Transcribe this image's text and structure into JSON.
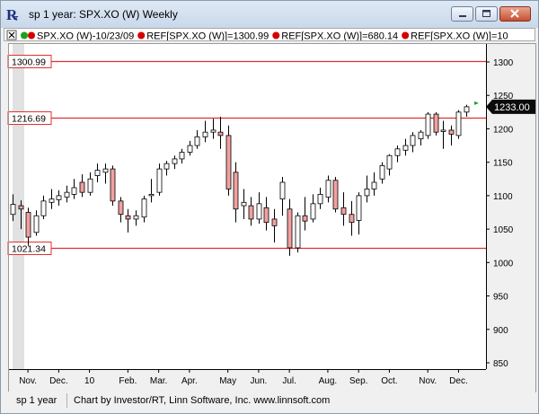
{
  "window": {
    "title": "sp 1 year: SPX.XO (W) Weekly"
  },
  "legend": {
    "items": [
      {
        "text": "SPX.XO (W)-10/23/09",
        "dots": [
          "#1ea01e",
          "#d40000"
        ]
      },
      {
        "text": "REF[SPX.XO (W)]=1300.99",
        "dots": [
          "#d40000"
        ]
      },
      {
        "text": "REF[SPX.XO (W)]=680.14",
        "dots": [
          "#d40000"
        ]
      },
      {
        "text": "REF[SPX.XO (W)]=10",
        "dots": [
          "#d40000"
        ]
      }
    ]
  },
  "status": {
    "left": "sp 1 year",
    "right": "Chart by Investor/RT, Linn Software, Inc. www.linnsoft.com"
  },
  "chart_data": {
    "type": "candlestick",
    "symbol": "SPX.XO (W)",
    "title": "",
    "ylim": [
      850,
      1310
    ],
    "yticks": [
      850,
      900,
      950,
      1000,
      1050,
      1100,
      1150,
      1200,
      1250,
      1300
    ],
    "x_labels": [
      {
        "label": "Nov.",
        "index": 2
      },
      {
        "label": "Dec.",
        "index": 6
      },
      {
        "label": "10",
        "index": 10
      },
      {
        "label": "Feb.",
        "index": 15
      },
      {
        "label": "Mar.",
        "index": 19
      },
      {
        "label": "Apr.",
        "index": 23
      },
      {
        "label": "May",
        "index": 28
      },
      {
        "label": "Jun.",
        "index": 32
      },
      {
        "label": "Jul.",
        "index": 36
      },
      {
        "label": "Aug.",
        "index": 41
      },
      {
        "label": "Sep.",
        "index": 45
      },
      {
        "label": "Oct.",
        "index": 49
      },
      {
        "label": "Nov.",
        "index": 54
      },
      {
        "label": "Dec.",
        "index": 58
      }
    ],
    "reference_lines": [
      {
        "label": "1300.99",
        "value": 1300.99,
        "color": "#e03030"
      },
      {
        "label": "1216.69",
        "value": 1216.69,
        "color": "#e03030"
      },
      {
        "label": "1021.34",
        "value": 1021.34,
        "color": "#e03030"
      }
    ],
    "last_price": {
      "label": "1233.00",
      "value": 1233.0
    },
    "colors": {
      "up": "#ffffff",
      "down": "#f2a0a0",
      "wick": "#000000",
      "refline": "#e03030"
    },
    "candles": [
      {
        "open": 1072,
        "high": 1102,
        "low": 1062,
        "close": 1087
      },
      {
        "open": 1085,
        "high": 1093,
        "low": 1050,
        "close": 1080
      },
      {
        "open": 1075,
        "high": 1082,
        "low": 1025,
        "close": 1038
      },
      {
        "open": 1045,
        "high": 1078,
        "low": 1040,
        "close": 1070
      },
      {
        "open": 1070,
        "high": 1100,
        "low": 1065,
        "close": 1092
      },
      {
        "open": 1090,
        "high": 1110,
        "low": 1080,
        "close": 1095
      },
      {
        "open": 1094,
        "high": 1108,
        "low": 1085,
        "close": 1100
      },
      {
        "open": 1098,
        "high": 1115,
        "low": 1090,
        "close": 1105
      },
      {
        "open": 1102,
        "high": 1125,
        "low": 1095,
        "close": 1112
      },
      {
        "open": 1120,
        "high": 1132,
        "low": 1098,
        "close": 1105
      },
      {
        "open": 1105,
        "high": 1135,
        "low": 1100,
        "close": 1125
      },
      {
        "open": 1130,
        "high": 1148,
        "low": 1120,
        "close": 1138
      },
      {
        "open": 1135,
        "high": 1148,
        "low": 1118,
        "close": 1140
      },
      {
        "open": 1140,
        "high": 1145,
        "low": 1085,
        "close": 1092
      },
      {
        "open": 1092,
        "high": 1098,
        "low": 1060,
        "close": 1072
      },
      {
        "open": 1070,
        "high": 1080,
        "low": 1045,
        "close": 1065
      },
      {
        "open": 1065,
        "high": 1078,
        "low": 1055,
        "close": 1070
      },
      {
        "open": 1068,
        "high": 1100,
        "low": 1060,
        "close": 1095
      },
      {
        "open": 1100,
        "high": 1125,
        "low": 1090,
        "close": 1102
      },
      {
        "open": 1105,
        "high": 1148,
        "low": 1100,
        "close": 1140
      },
      {
        "open": 1140,
        "high": 1152,
        "low": 1130,
        "close": 1148
      },
      {
        "open": 1148,
        "high": 1160,
        "low": 1140,
        "close": 1155
      },
      {
        "open": 1155,
        "high": 1170,
        "low": 1148,
        "close": 1165
      },
      {
        "open": 1165,
        "high": 1182,
        "low": 1160,
        "close": 1175
      },
      {
        "open": 1175,
        "high": 1198,
        "low": 1170,
        "close": 1188
      },
      {
        "open": 1188,
        "high": 1212,
        "low": 1180,
        "close": 1195
      },
      {
        "open": 1195,
        "high": 1215,
        "low": 1185,
        "close": 1198
      },
      {
        "open": 1195,
        "high": 1218,
        "low": 1170,
        "close": 1190
      },
      {
        "open": 1190,
        "high": 1205,
        "low": 1100,
        "close": 1110
      },
      {
        "open": 1135,
        "high": 1150,
        "low": 1060,
        "close": 1080
      },
      {
        "open": 1085,
        "high": 1110,
        "low": 1065,
        "close": 1090
      },
      {
        "open": 1085,
        "high": 1098,
        "low": 1055,
        "close": 1065
      },
      {
        "open": 1065,
        "high": 1105,
        "low": 1058,
        "close": 1088
      },
      {
        "open": 1082,
        "high": 1098,
        "low": 1048,
        "close": 1060
      },
      {
        "open": 1065,
        "high": 1080,
        "low": 1030,
        "close": 1055
      },
      {
        "open": 1095,
        "high": 1128,
        "low": 1070,
        "close": 1120
      },
      {
        "open": 1080,
        "high": 1095,
        "low": 1010,
        "close": 1022
      },
      {
        "open": 1022,
        "high": 1075,
        "low": 1015,
        "close": 1070
      },
      {
        "open": 1070,
        "high": 1098,
        "low": 1048,
        "close": 1062
      },
      {
        "open": 1065,
        "high": 1102,
        "low": 1060,
        "close": 1088
      },
      {
        "open": 1088,
        "high": 1112,
        "low": 1080,
        "close": 1102
      },
      {
        "open": 1098,
        "high": 1130,
        "low": 1090,
        "close": 1123
      },
      {
        "open": 1123,
        "high": 1128,
        "low": 1075,
        "close": 1080
      },
      {
        "open": 1082,
        "high": 1105,
        "low": 1055,
        "close": 1072
      },
      {
        "open": 1072,
        "high": 1092,
        "low": 1040,
        "close": 1060
      },
      {
        "open": 1063,
        "high": 1105,
        "low": 1042,
        "close": 1100
      },
      {
        "open": 1100,
        "high": 1130,
        "low": 1090,
        "close": 1110
      },
      {
        "open": 1110,
        "high": 1135,
        "low": 1100,
        "close": 1120
      },
      {
        "open": 1125,
        "high": 1150,
        "low": 1118,
        "close": 1145
      },
      {
        "open": 1140,
        "high": 1162,
        "low": 1130,
        "close": 1160
      },
      {
        "open": 1160,
        "high": 1175,
        "low": 1150,
        "close": 1170
      },
      {
        "open": 1168,
        "high": 1185,
        "low": 1160,
        "close": 1175
      },
      {
        "open": 1175,
        "high": 1195,
        "low": 1165,
        "close": 1190
      },
      {
        "open": 1185,
        "high": 1198,
        "low": 1175,
        "close": 1195
      },
      {
        "open": 1190,
        "high": 1225,
        "low": 1185,
        "close": 1222
      },
      {
        "open": 1222,
        "high": 1225,
        "low": 1190,
        "close": 1195
      },
      {
        "open": 1196,
        "high": 1212,
        "low": 1170,
        "close": 1198
      },
      {
        "open": 1198,
        "high": 1205,
        "low": 1175,
        "close": 1192
      },
      {
        "open": 1190,
        "high": 1228,
        "low": 1185,
        "close": 1225
      },
      {
        "open": 1225,
        "high": 1236,
        "low": 1218,
        "close": 1233
      }
    ]
  }
}
